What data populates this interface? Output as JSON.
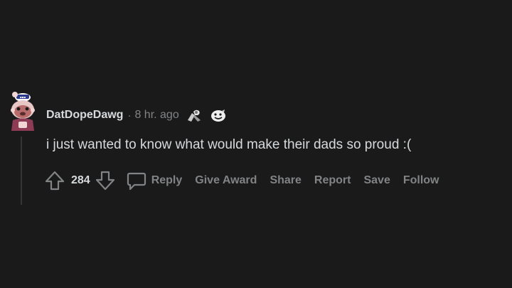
{
  "comment": {
    "username": "DatDopeDawg",
    "separator": "·",
    "time": "8 hr. ago",
    "body": "i just wanted to know what would make their dads so proud :(",
    "score": "284",
    "awards": [
      "ribbon-award-icon",
      "smiling-face-award-icon"
    ],
    "actions": {
      "reply": "Reply",
      "give_award": "Give Award",
      "share": "Share",
      "report": "Report",
      "save": "Save",
      "follow": "Follow"
    }
  },
  "colors": {
    "background": "#1a1a1b",
    "primary_text": "#d7dadc",
    "secondary_text": "#818384",
    "thread_line": "#343536"
  }
}
